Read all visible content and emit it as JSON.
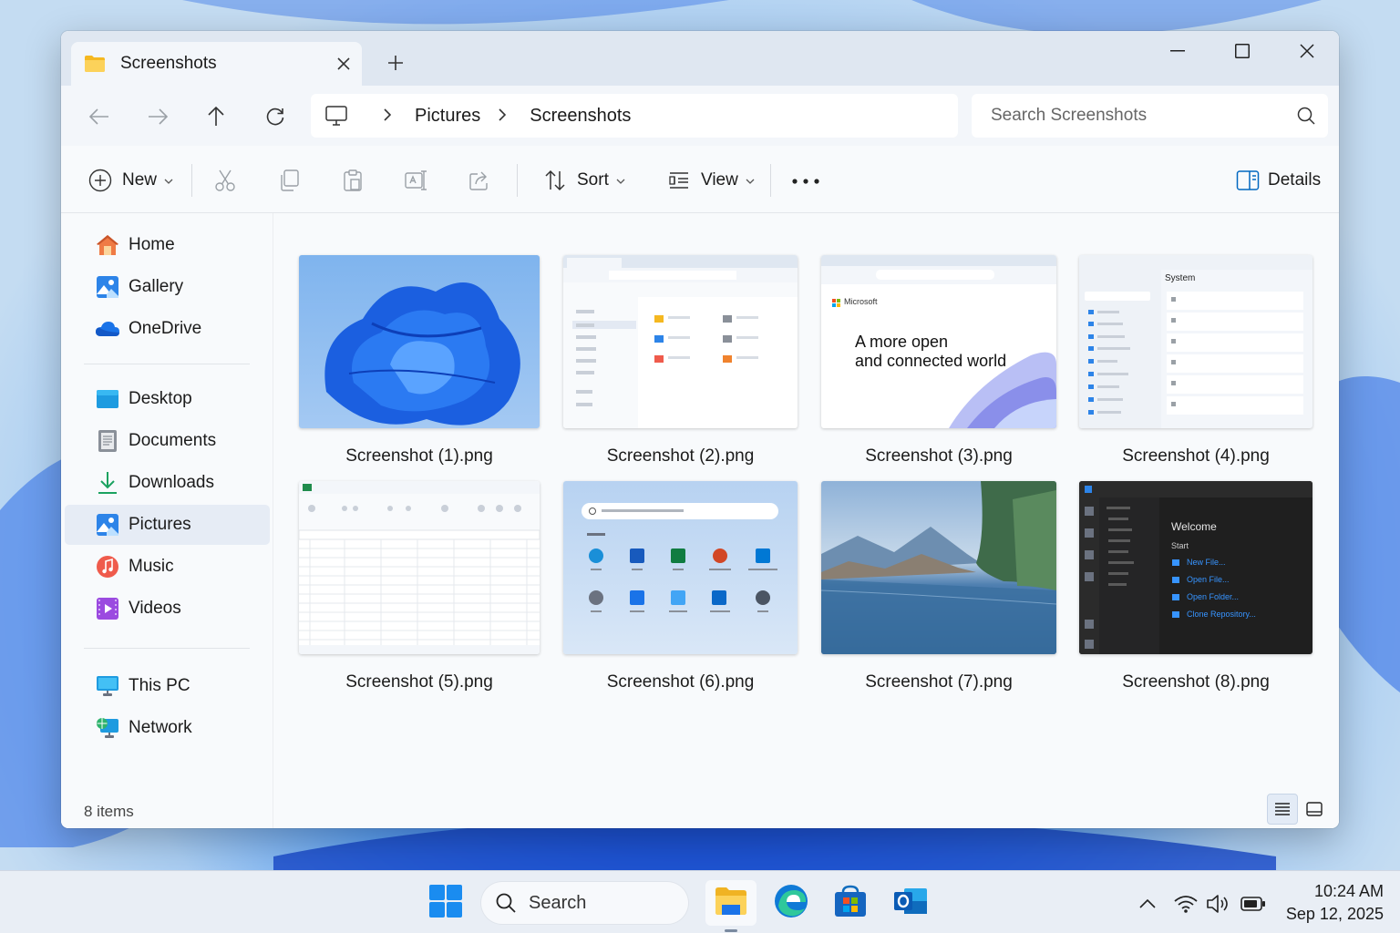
{
  "window": {
    "tab_title": "Screenshots",
    "new_tab_label": "+"
  },
  "navigation": {
    "breadcrumb": [
      "Pictures",
      "Screenshots"
    ],
    "search_placeholder": "Search Screenshots"
  },
  "toolbar": {
    "new_label": "New",
    "sort_label": "Sort",
    "view_label": "View",
    "more_label": "•••",
    "details_label": "Details"
  },
  "sidebar": {
    "items": [
      {
        "label": "Home",
        "icon": "home-icon"
      },
      {
        "label": "Gallery",
        "icon": "gallery-icon"
      },
      {
        "label": "OneDrive",
        "icon": "onedrive-icon"
      },
      {
        "label": "Desktop",
        "icon": "desktop-folder-icon"
      },
      {
        "label": "Documents",
        "icon": "documents-icon"
      },
      {
        "label": "Downloads",
        "icon": "downloads-icon"
      },
      {
        "label": "Pictures",
        "icon": "pictures-icon",
        "active": true
      },
      {
        "label": "Music",
        "icon": "music-icon"
      },
      {
        "label": "Videos",
        "icon": "videos-icon"
      },
      {
        "label": "This PC",
        "icon": "this-pc-icon"
      },
      {
        "label": "Network",
        "icon": "network-icon"
      }
    ]
  },
  "files": [
    {
      "name": "Screenshot (1).png"
    },
    {
      "name": "Screenshot (2).png"
    },
    {
      "name": "Screenshot (3).png",
      "thumb_line1": "A more open",
      "thumb_line2": "and connected world",
      "thumb_brand": "Microsoft"
    },
    {
      "name": "Screenshot (4).png",
      "thumb_heading": "System"
    },
    {
      "name": "Screenshot (5).png"
    },
    {
      "name": "Screenshot (6).png"
    },
    {
      "name": "Screenshot (7).png"
    },
    {
      "name": "Screenshot (8).png",
      "thumb_heading": "Welcome",
      "thumb_sub": "Start",
      "thumb_links": [
        "New File...",
        "Open File...",
        "Open Folder...",
        "Clone Repository..."
      ]
    }
  ],
  "status": {
    "item_count": "8 items"
  },
  "taskbar": {
    "search_label": "Search",
    "time": "10:24 AM",
    "date": "Sep 12, 2025"
  },
  "colors": {
    "accent": "#0067c0",
    "folder": "#f8c23b",
    "window_bg": "#f8fafc",
    "titlebar": "#dfe7f1"
  }
}
